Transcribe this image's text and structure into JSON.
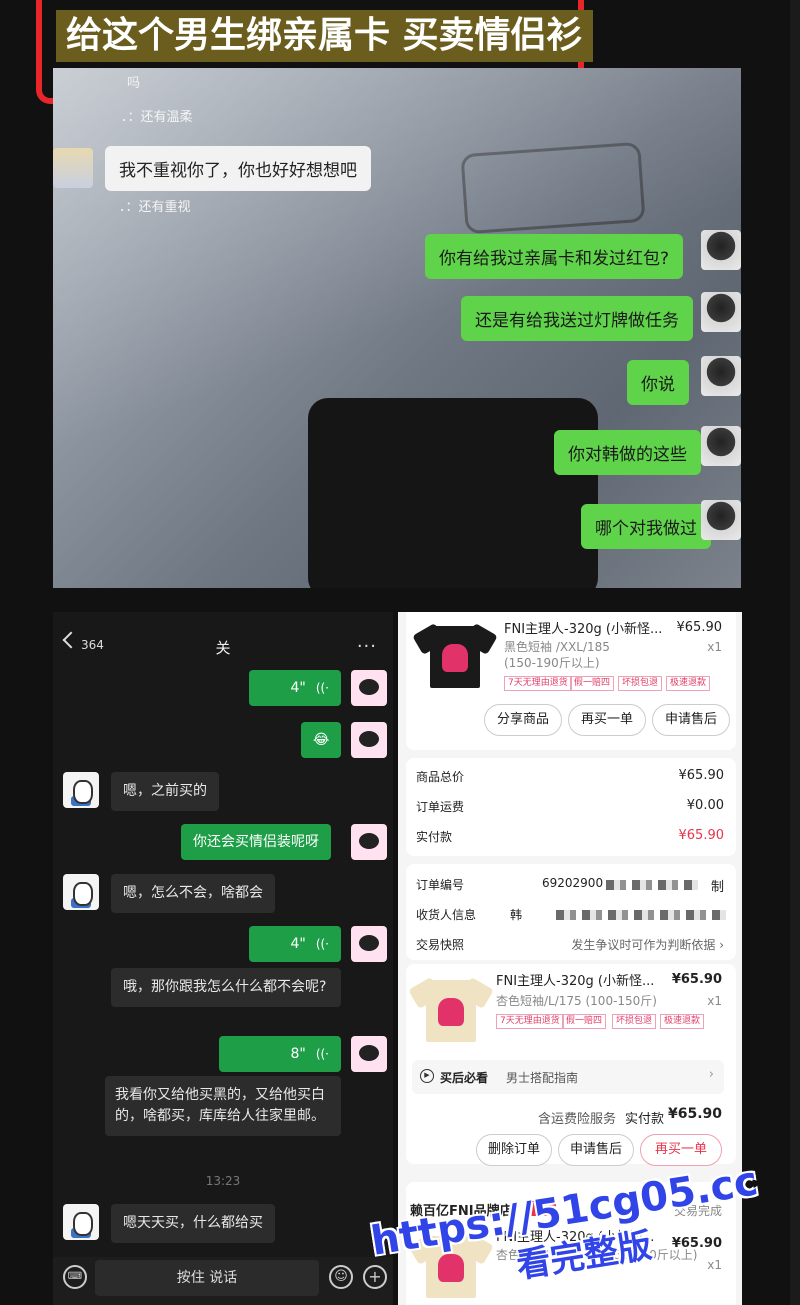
{
  "banner": {
    "title": "给这个男生绑亲属卡 买卖情侣衫"
  },
  "photo_chat": {
    "small_1": "吗",
    "small_2": "．：还有温柔",
    "left_bubble": "我不重视你了，你也好好想想吧",
    "small_3": "．：还有重视",
    "right_bubbles": [
      "你有给我过亲属卡和发过红包?",
      "还是有给我送过灯牌做任务",
      "你说",
      "你对韩做的这些",
      "哪个对我做过"
    ]
  },
  "chat": {
    "unread_count": "364",
    "title": "关",
    "voice_1": "4\"",
    "emoji_msg": "😂",
    "friend_1": "嗯，之前买的",
    "me_1": "你还会买情侣装呢呀",
    "friend_2": "嗯，怎么不会，啥都会",
    "voice_2": "4\"",
    "friend_3": "哦，那你跟我怎么什么都不会呢?",
    "voice_3": "8\"",
    "friend_4": "我看你又给他买黑的，又给他买白的，啥都买，库库给人往家里邮。",
    "time": "13:23",
    "friend_5": "嗯天天买，什么都给买",
    "hold_to_talk": "按住 说话"
  },
  "order": {
    "item1": {
      "name": "FNI主理人-320g (小新怪...",
      "price": "¥65.90",
      "spec1": "黑色短袖 /XXL/185",
      "spec2": "(150-190斤以上)",
      "qty": "x1",
      "tags": [
        "7天无理由退货",
        "假一赔四",
        "坏损包退",
        "极速退款"
      ],
      "shirt_color": "#1a1a1a"
    },
    "buttons1": [
      "分享商品",
      "再买一单",
      "申请售后"
    ],
    "summary": {
      "total_label": "商品总价",
      "total": "¥65.90",
      "ship_label": "订单运费",
      "ship": "¥0.00",
      "paid_label": "实付款",
      "paid": "¥65.90"
    },
    "info": {
      "order_no_label": "订单编号",
      "order_no": "69202900",
      "order_no_suffix": "制",
      "receiver_label": "收货人信息",
      "receiver": "韩",
      "snapshot_label": "交易快照",
      "snapshot": "发生争议时可作为判断依据 ›"
    },
    "item2": {
      "name": "FNI主理人-320g (小新怪...",
      "price": "¥65.90",
      "spec": "杏色短袖/L/175 (100-150斤)",
      "qty": "x1",
      "tags": [
        "7天无理由退货",
        "假一赔四",
        "坏损包退",
        "极速退款"
      ],
      "shirt_color": "#efe3c4"
    },
    "guide_label": "买后必看",
    "guide": "男士搭配指南",
    "insurance": "含运费险服务",
    "paid_label2": "实付款",
    "paid2": "¥65.90",
    "buttons2": [
      "删除订单",
      "申请售后",
      "再买一单"
    ],
    "store": "赖百亿FNI品牌店",
    "store_status": "交易完成",
    "item3_name": "FNI主理人-320g (小新怪...",
    "item3_price": "¥65.90",
    "item3_spec": "杏色短袖/XXL/185 (150-190斤以上)",
    "item3_qty": "x1"
  },
  "watermark": {
    "url": "https://51cg05.cc",
    "label": "看完整版"
  }
}
